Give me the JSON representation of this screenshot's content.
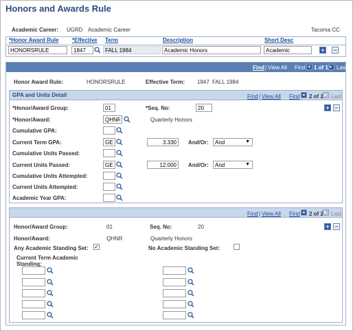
{
  "page": {
    "title": "Honors and Awards Rule"
  },
  "header": {
    "career_label": "Academic Career:",
    "career_code": "UGRD",
    "career_desc": "Academic Career",
    "institution": "Tacoma CC"
  },
  "key_grid": {
    "columns": [
      "*Honor Award Rule",
      "*Effective",
      "Term",
      "Description",
      "Short Desc"
    ],
    "row": {
      "rule": "HONORSRULE",
      "effective": "1847",
      "term": "FALL 1984",
      "description": "Academic Honors",
      "short_desc": "Academic"
    }
  },
  "rule_bar": {
    "find": "Find",
    "view_all": "View All",
    "first": "First",
    "count": "1 of 1",
    "last": "Last"
  },
  "rule_info": {
    "rule_label": "Honor Award Rule:",
    "rule_value": "HONORSRULE",
    "term_label": "Effective Term:",
    "term_code": "1847",
    "term_desc": "FALL 1984"
  },
  "gpa_section": {
    "title": "GPA and Units Detail",
    "find": "Find",
    "view_all": "View All",
    "first": "First",
    "count": "2 of 2",
    "last": "Last",
    "group_label": "*Honor/Award Group:",
    "group_value": "01",
    "seq_label": "*Seq. No:",
    "seq_value": "20",
    "award_label": "*Honor/Award:",
    "award_value": "QHNR",
    "award_desc": "Quarterly Honors",
    "cum_gpa_label": "Cumulative GPA:",
    "cur_term_gpa_label": "Current Term GPA:",
    "cur_term_gpa_op": "GE",
    "cur_term_gpa_value": "3.330",
    "andor_label": "And/Or:",
    "andor1": "And",
    "cum_units_passed_label": "Cumulative Units Passed:",
    "cur_units_passed_label": "Current Units Passed:",
    "cur_units_passed_op": "GE",
    "cur_units_passed_value": "12.000",
    "andor2": "And",
    "cum_units_attempted_label": "Cumulative Units Attempted:",
    "cur_units_attempted_label": "Current Units Attempted:",
    "acad_year_gpa_label": "Academic Year GPA:"
  },
  "standing_section": {
    "find": "Find",
    "view_all": "View All",
    "first": "First",
    "count": "2 of 2",
    "last": "Last",
    "group_label": "Honor/Award Group:",
    "group_value": "01",
    "seq_label": "Seq. No:",
    "seq_value": "20",
    "award_label": "Honor/Award:",
    "award_value": "QHNR",
    "award_desc": "Quarterly Honors",
    "any_label": "Any Academic Standing Set:",
    "any_checked": true,
    "no_label": "No Academic Standing Set:",
    "no_checked": false,
    "current_label_1": "Current Term Academic",
    "current_label_2": "Standing:"
  }
}
